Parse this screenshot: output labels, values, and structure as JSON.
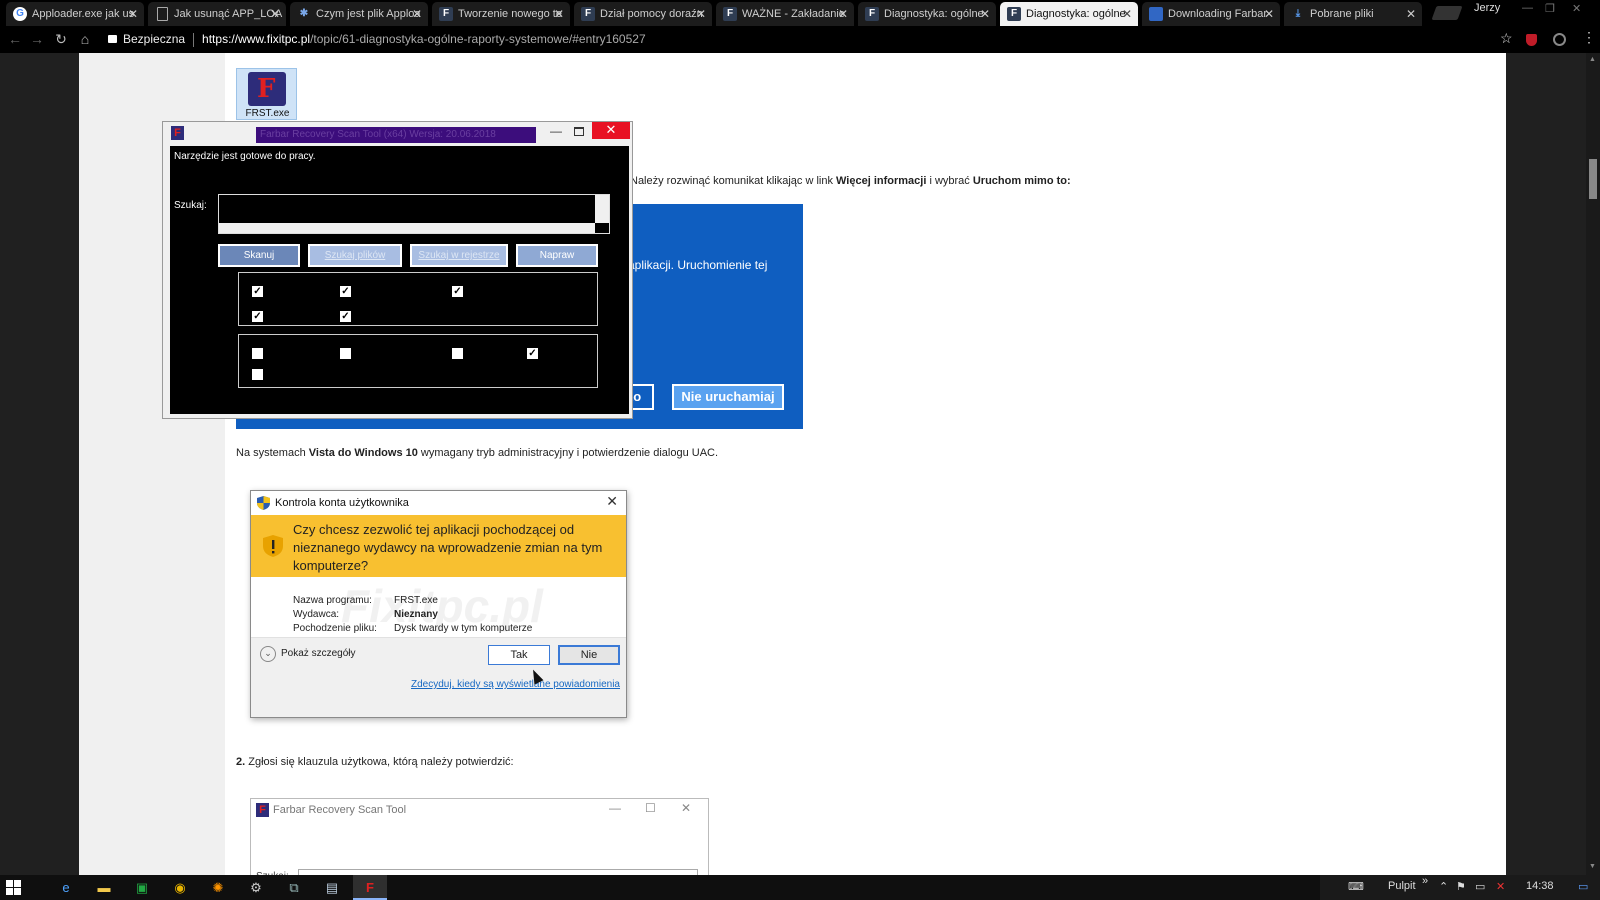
{
  "browser": {
    "tabs": [
      {
        "label": "Apploader.exe jak us",
        "favicon": "google-icon"
      },
      {
        "label": "Jak usunąć APP_LOA",
        "favicon": "doc-icon"
      },
      {
        "label": "Czym jest plik Apploa",
        "favicon": "site-icon"
      },
      {
        "label": "Tworzenie nowego te",
        "favicon": "fixitpc-icon"
      },
      {
        "label": "Dział pomocy doraźn",
        "favicon": "fixitpc-icon"
      },
      {
        "label": "WAŻNE - Zakładanie",
        "favicon": "fixitpc-icon"
      },
      {
        "label": "Diagnostyka: ogólne",
        "favicon": "fixitpc-icon"
      },
      {
        "label": "Diagnostyka: ogólne",
        "favicon": "fixitpc-icon",
        "active": true
      },
      {
        "label": "Downloading Farbar",
        "favicon": "blue-icon"
      },
      {
        "label": "Pobrane pliki",
        "favicon": "download-icon"
      }
    ],
    "user": "Jerzy",
    "secure_label": "Bezpieczna",
    "url_host": "https://www.fixitpc.pl",
    "url_path": "/topic/61-diagnostyka-ogólne-raporty-systemowe/#entry160527"
  },
  "page": {
    "desktop_icon_label": "FRST.exe",
    "intro_before": "Należy rozwinąć komunikat klikając w link ",
    "intro_more": "Więcej informacji",
    "intro_mid": " i wybrać ",
    "intro_run": "Uruchom mimo to:",
    "smartscreen_text": "aplikacji. Uruchomienie tej",
    "smartscreen_run": "to",
    "smartscreen_dont": "Nie uruchamiaj",
    "vista_before": "Na systemach ",
    "vista_bold": "Vista do Windows 10",
    "vista_after": " wymagany tryb administracyjny i potwierdzenie dialogu UAC.",
    "step2_num": "2.",
    "step2_text": " Zgłosi się klauzula użytkowa, którą należy potwierdzić:"
  },
  "uac": {
    "title": "Kontrola konta użytkownika",
    "question": "Czy chcesz zezwolić tej aplikacji pochodzącej od nieznanego wydawcy na wprowadzenie zmian na tym komputerze?",
    "watermark": "Fixitpc.pl",
    "program_label": "Nazwa programu:",
    "program_value": "FRST.exe",
    "publisher_label": "Wydawca:",
    "publisher_value": "Nieznany",
    "origin_label": "Pochodzenie pliku:",
    "origin_value": "Dysk twardy w tym komputerze",
    "details": "Pokaż szczegóły",
    "yes": "Tak",
    "no": "Nie",
    "link": "Zdecyduj, kiedy są wyświetlane powiadomienia"
  },
  "frst": {
    "title": "Farbar Recovery Scan Tool (x64) Wersja: 20.06.2018",
    "status": "Narzędzie jest gotowe do pracy.",
    "search_label": "Szukaj:",
    "buttons": [
      "Skanuj",
      "Szukaj plików",
      "Szukaj w rejestrze",
      "Napraw"
    ]
  },
  "frst2": {
    "title": "Farbar Recovery Scan Tool",
    "search_label": "Szukaj:"
  },
  "taskbar": {
    "desktop_label": "Pulpit",
    "time": "14:38"
  }
}
